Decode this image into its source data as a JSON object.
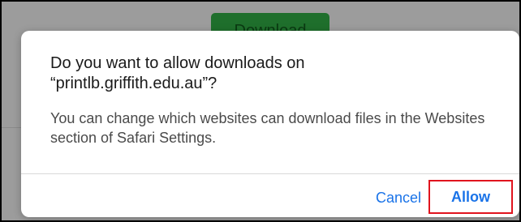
{
  "background": {
    "download_button_label": "Download"
  },
  "dialog": {
    "title": "Do you want to allow downloads on\n“printlb.griffith.edu.au”?",
    "message": "You can change which websites can download files in the Websites section of Safari Settings.",
    "cancel_label": "Cancel",
    "allow_label": "Allow"
  },
  "colors": {
    "accent": "#1a73e8",
    "highlight": "#e0141e",
    "background_button": "#1f6f2c"
  }
}
